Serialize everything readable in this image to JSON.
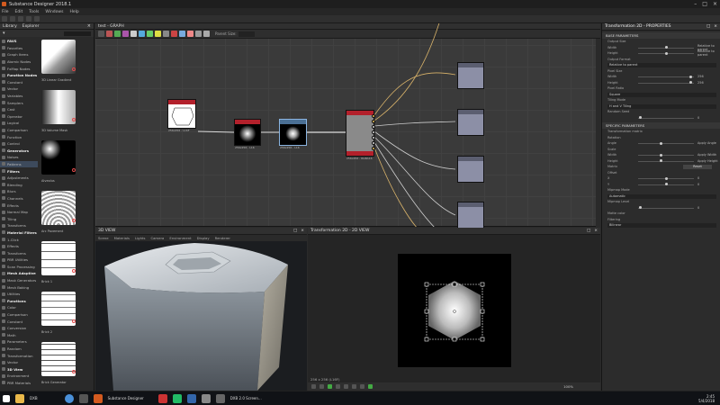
{
  "window": {
    "title": "Substance Designer 2018.1"
  },
  "menu": [
    "File",
    "Edit",
    "Tools",
    "Windows",
    "Help"
  ],
  "library": {
    "tabs": [
      "Library",
      "Explorer"
    ],
    "tree": [
      {
        "label": "FAVS",
        "hdr": true
      },
      {
        "label": "Favorites"
      },
      {
        "label": "Graph Items"
      },
      {
        "label": "Atomic Nodes"
      },
      {
        "label": "FxMap Nodes"
      },
      {
        "label": "Function Nodes",
        "hdr": true
      },
      {
        "label": "Constant"
      },
      {
        "label": "Vector"
      },
      {
        "label": "Variables"
      },
      {
        "label": "Samplers"
      },
      {
        "label": "Cast"
      },
      {
        "label": "Operator"
      },
      {
        "label": "Logical"
      },
      {
        "label": "Comparison"
      },
      {
        "label": "Function"
      },
      {
        "label": "Control"
      },
      {
        "label": "Generators",
        "hdr": true
      },
      {
        "label": "Noises"
      },
      {
        "label": "Patterns",
        "sel": true
      },
      {
        "label": "Filters",
        "hdr": true
      },
      {
        "label": "Adjustments"
      },
      {
        "label": "Blending"
      },
      {
        "label": "Blurs"
      },
      {
        "label": "Channels"
      },
      {
        "label": "Effects"
      },
      {
        "label": "Normal Map"
      },
      {
        "label": "Tiling"
      },
      {
        "label": "Transforms"
      },
      {
        "label": "Material Filters",
        "hdr": true
      },
      {
        "label": "1-Click"
      },
      {
        "label": "Effects"
      },
      {
        "label": "Transforms"
      },
      {
        "label": "PBR Utilities"
      },
      {
        "label": "Scan Processing"
      },
      {
        "label": "Mesh Adaptive",
        "hdr": true
      },
      {
        "label": "Mask Generators"
      },
      {
        "label": "Mesh Baking"
      },
      {
        "label": "Utilities"
      },
      {
        "label": "Functions",
        "hdr": true
      },
      {
        "label": "Color"
      },
      {
        "label": "Comparison"
      },
      {
        "label": "Constant"
      },
      {
        "label": "Conversion"
      },
      {
        "label": "Math"
      },
      {
        "label": "Parameters"
      },
      {
        "label": "Random"
      },
      {
        "label": "Transformation"
      },
      {
        "label": "Vector"
      },
      {
        "label": "3D View",
        "hdr": true
      },
      {
        "label": "Environment"
      },
      {
        "label": "PBR Materials"
      }
    ],
    "thumbs": [
      {
        "label": "3D Linear Gradient"
      },
      {
        "label": "3D Volume Mask"
      },
      {
        "label": "Alveolus"
      },
      {
        "label": "Arc Pavement"
      },
      {
        "label": "Brick 1"
      },
      {
        "label": "Brick 2"
      },
      {
        "label": "Brick Generator"
      }
    ]
  },
  "graph": {
    "title": "test - GRAPH",
    "param_label": "Parent Size:",
    "nodes": [
      {
        "cap": "256x256 - L16F"
      },
      {
        "cap": "256x256 - L16"
      },
      {
        "cap": "256x256 - L16"
      },
      {
        "cap": "256x256 - RGBA16"
      }
    ]
  },
  "view3d": {
    "title": "3D VIEW",
    "menu": [
      "Scene",
      "Materials",
      "Lights",
      "Camera",
      "Environment",
      "Display",
      "Renderer"
    ]
  },
  "view2d": {
    "title": "Transformation 2D - 2D VIEW",
    "footer": "256 x 256 (L16F)",
    "zoom": "100%"
  },
  "properties": {
    "title": "Transformation 2D - PROPERTIES",
    "sections": [
      {
        "type": "sec",
        "label": "BASE PARAMETERS"
      },
      {
        "type": "row",
        "label": "Output Size"
      },
      {
        "type": "slider",
        "label": "Width",
        "value": "Relative to parent",
        "pos": 0.5
      },
      {
        "type": "slider",
        "label": "Height",
        "value": "Relative to parent",
        "pos": 0.5
      },
      {
        "type": "row",
        "label": "Output Format"
      },
      {
        "type": "dd",
        "value": "Relative to parent"
      },
      {
        "type": "row",
        "label": "Pixel Size"
      },
      {
        "type": "slider",
        "label": "Width",
        "value": "256",
        "pos": 0.95
      },
      {
        "type": "slider",
        "label": "Height",
        "value": "256",
        "pos": 0.95
      },
      {
        "type": "row",
        "label": "Pixel Ratio"
      },
      {
        "type": "dd",
        "value": "Square"
      },
      {
        "type": "row",
        "label": "Tiling Mode"
      },
      {
        "type": "dd",
        "value": "H and V Tiling"
      },
      {
        "type": "row",
        "label": "Random Seed"
      },
      {
        "type": "slider",
        "label": "",
        "value": "0",
        "pos": 0.02
      },
      {
        "type": "sec",
        "label": "SPECIFIC PARAMETERS"
      },
      {
        "type": "row",
        "label": "Transformation matrix"
      },
      {
        "type": "row",
        "label": "Rotation"
      },
      {
        "type": "slider",
        "label": "Angle",
        "value": "Apply Angle",
        "pos": 0.4
      },
      {
        "type": "row",
        "label": "Scale"
      },
      {
        "type": "slider",
        "label": "Width",
        "value": "Apply Width",
        "pos": 0.4
      },
      {
        "type": "slider",
        "label": "Height",
        "value": "Apply Height",
        "pos": 0.4
      },
      {
        "type": "btn",
        "label": "Matrix",
        "value": "Reset"
      },
      {
        "type": "row",
        "label": "Offset"
      },
      {
        "type": "slider",
        "label": "X",
        "value": "0",
        "pos": 0.5
      },
      {
        "type": "slider",
        "label": "Y",
        "value": "0",
        "pos": 0.5
      },
      {
        "type": "row",
        "label": "Mipmap Mode"
      },
      {
        "type": "dd",
        "value": "Automatic"
      },
      {
        "type": "row",
        "label": "Mipmap Level"
      },
      {
        "type": "slider",
        "label": "",
        "value": "0",
        "pos": 0.02
      },
      {
        "type": "row",
        "label": "Matte color"
      },
      {
        "type": "row",
        "label": "Filtering"
      },
      {
        "type": "dd",
        "value": "Bilinear"
      }
    ]
  },
  "taskbar": {
    "items": [
      "DXB",
      "Substance Designer",
      "DXB 2.0 Screen..."
    ],
    "time": "2:45",
    "date": "5/4/2018"
  }
}
